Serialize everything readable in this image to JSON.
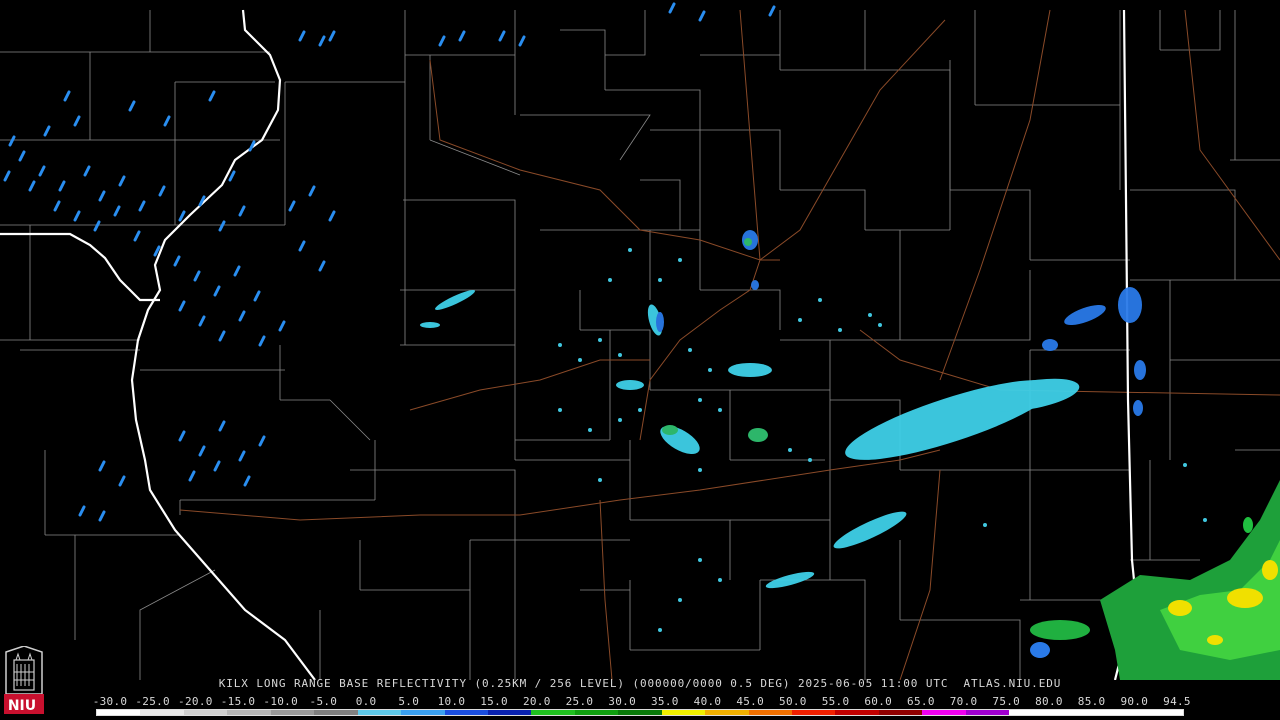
{
  "product": {
    "caption": "KILX LONG RANGE BASE REFLECTIVITY (0.25KM / 256 LEVEL) (000000/0000 0.5 DEG) 2025-06-05 11:00 UTC  ATLAS.NIU.EDU"
  },
  "logo": {
    "text": "NIU",
    "color": "#c8102e"
  },
  "legend": {
    "ticks": [
      "-30.0",
      "-25.0",
      "-20.0",
      "-15.0",
      "-10.0",
      "-5.0",
      "0.0",
      "5.0",
      "10.0",
      "15.0",
      "20.0",
      "25.0",
      "30.0",
      "35.0",
      "40.0",
      "45.0",
      "50.0",
      "55.0",
      "60.0",
      "65.0",
      "70.0",
      "75.0",
      "80.0",
      "85.0",
      "90.0",
      "94.5"
    ],
    "colors": [
      "#ffffff",
      "#e8e8e8",
      "#cfcfcf",
      "#b5b5b5",
      "#9a9a9a",
      "#808080",
      "#5ec8e8",
      "#3aa0f0",
      "#1a4ee0",
      "#0a22b0",
      "#20c020",
      "#10a010",
      "#0a7a0a",
      "#f0f000",
      "#f0b000",
      "#f07000",
      "#f02000",
      "#c00000",
      "#900000",
      "#f000f0",
      "#a000d0",
      "#ffffff",
      "#ffffff",
      "#ffffff",
      "#ffffff"
    ]
  },
  "map_colors": {
    "county_lines": "#8a8a8a",
    "state_lines": "#ffffff",
    "highways": "#8a4a28"
  }
}
